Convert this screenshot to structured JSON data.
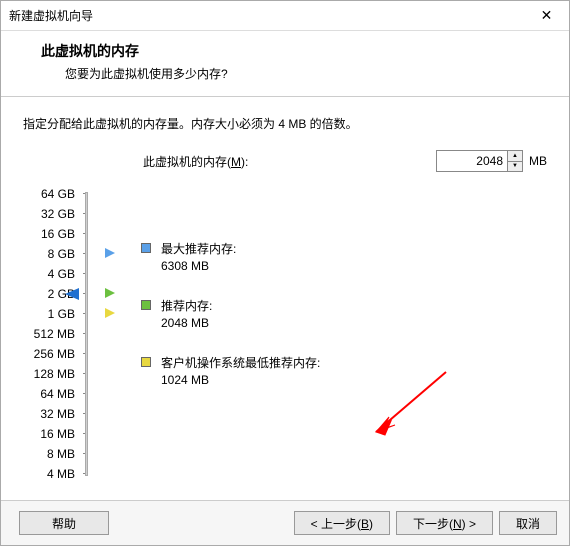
{
  "window": {
    "title": "新建虚拟机向导",
    "close": "✕"
  },
  "header": {
    "title": "此虚拟机的内存",
    "sub": "您要为此虚拟机使用多少内存?"
  },
  "instruction": "指定分配给此虚拟机的内存量。内存大小必须为 4 MB 的倍数。",
  "memory": {
    "label_prefix": "此虚拟机的内存(",
    "label_mnemonic": "M",
    "label_suffix": "):",
    "value": "2048",
    "unit": "MB"
  },
  "scale": [
    "64 GB",
    "32 GB",
    "16 GB",
    "8 GB",
    "4 GB",
    "2 GB",
    "1 GB",
    "512 MB",
    "256 MB",
    "128 MB",
    "64 MB",
    "32 MB",
    "16 MB",
    "8 MB",
    "4 MB"
  ],
  "legend": {
    "max": {
      "label": "最大推荐内存:",
      "value": "6308 MB"
    },
    "rec": {
      "label": "推荐内存:",
      "value": "2048 MB"
    },
    "min": {
      "label": "客户机操作系统最低推荐内存:",
      "value": "1024 MB"
    }
  },
  "buttons": {
    "help": "帮助",
    "back_prefix": "< 上一步(",
    "back_m": "B",
    "back_suffix": ")",
    "next_prefix": "下一步(",
    "next_m": "N",
    "next_suffix": ") >",
    "cancel": "取消"
  }
}
